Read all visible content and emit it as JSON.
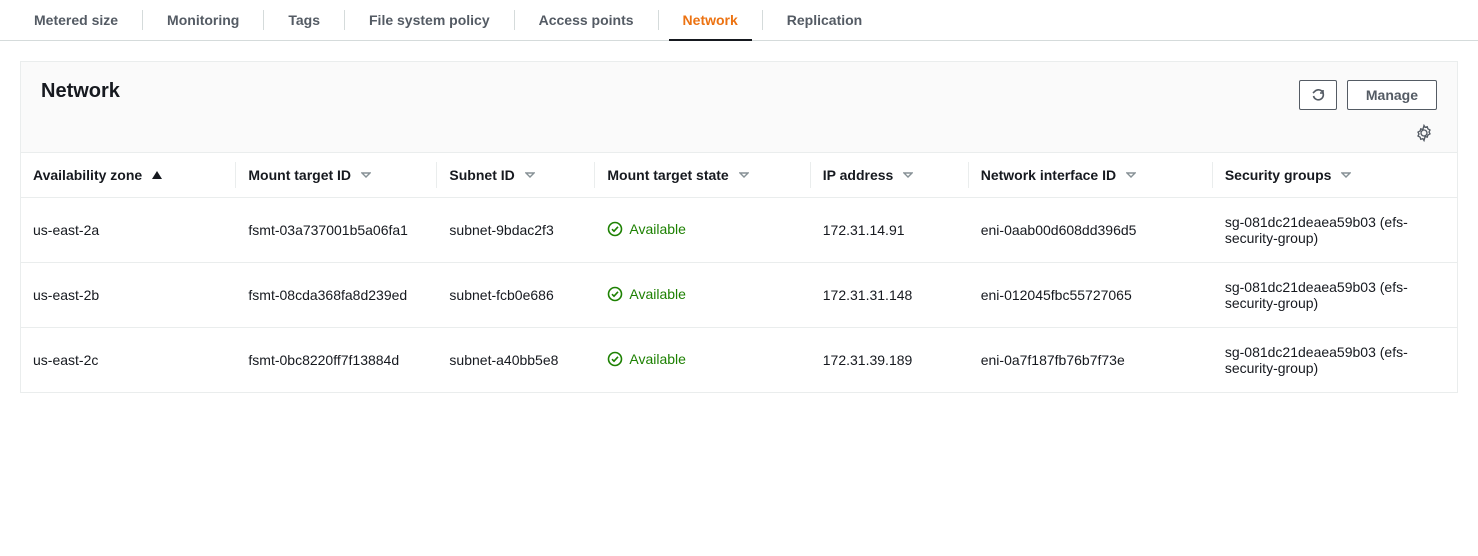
{
  "tabs": [
    {
      "label": "Metered size",
      "active": false
    },
    {
      "label": "Monitoring",
      "active": false
    },
    {
      "label": "Tags",
      "active": false
    },
    {
      "label": "File system policy",
      "active": false
    },
    {
      "label": "Access points",
      "active": false
    },
    {
      "label": "Network",
      "active": true
    },
    {
      "label": "Replication",
      "active": false
    }
  ],
  "panel": {
    "title": "Network",
    "manage_label": "Manage"
  },
  "table": {
    "headers": {
      "az": "Availability zone",
      "mt_id": "Mount target ID",
      "subnet": "Subnet ID",
      "state": "Mount target state",
      "ip": "IP address",
      "eni": "Network interface ID",
      "sg": "Security groups"
    },
    "rows": [
      {
        "az": "us-east-2a",
        "mt_id": "fsmt-03a737001b5a06fa1",
        "subnet": "subnet-9bdac2f3",
        "state": "Available",
        "ip": "172.31.14.91",
        "eni": "eni-0aab00d608dd396d5",
        "sg": "sg-081dc21deaea59b03 (efs-security-group)"
      },
      {
        "az": "us-east-2b",
        "mt_id": "fsmt-08cda368fa8d239ed",
        "subnet": "subnet-fcb0e686",
        "state": "Available",
        "ip": "172.31.31.148",
        "eni": "eni-012045fbc55727065",
        "sg": "sg-081dc21deaea59b03 (efs-security-group)"
      },
      {
        "az": "us-east-2c",
        "mt_id": "fsmt-0bc8220ff7f13884d",
        "subnet": "subnet-a40bb5e8",
        "state": "Available",
        "ip": "172.31.39.189",
        "eni": "eni-0a7f187fb76b7f73e",
        "sg": "sg-081dc21deaea59b03 (efs-security-group)"
      }
    ]
  }
}
